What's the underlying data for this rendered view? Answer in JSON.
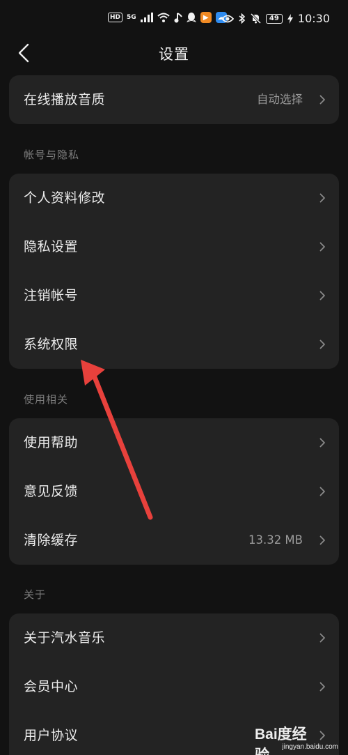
{
  "status_bar": {
    "hd": "HD",
    "network": "5G",
    "battery": "49",
    "time": "10:30",
    "icons": [
      "signal-icon",
      "wifi-icon",
      "music-note-icon",
      "qq-icon",
      "play-app-icon",
      "cloud-app-icon",
      "eye-icon",
      "bluetooth-icon",
      "mute-icon",
      "charging-icon"
    ]
  },
  "header": {
    "title": "设置",
    "back_icon": "chevron-left-icon"
  },
  "top_card": {
    "rows": [
      {
        "label": "在线播放音质",
        "value": "自动选择"
      }
    ]
  },
  "sections": [
    {
      "title": "帐号与隐私",
      "rows": [
        {
          "label": "个人资料修改"
        },
        {
          "label": "隐私设置"
        },
        {
          "label": "注销帐号"
        },
        {
          "label": "系统权限"
        }
      ]
    },
    {
      "title": "使用相关",
      "rows": [
        {
          "label": "使用帮助"
        },
        {
          "label": "意见反馈"
        },
        {
          "label": "清除缓存",
          "value": "13.32 MB"
        }
      ]
    },
    {
      "title": "关于",
      "rows": [
        {
          "label": "关于汽水音乐"
        },
        {
          "label": "会员中心"
        },
        {
          "label": "用户协议"
        }
      ]
    }
  ],
  "annotation": {
    "color": "#e8413c",
    "icon": "red-arrow-icon"
  },
  "watermark": {
    "logo": "Bai度经验",
    "url": "jingyan.baidu.com"
  }
}
